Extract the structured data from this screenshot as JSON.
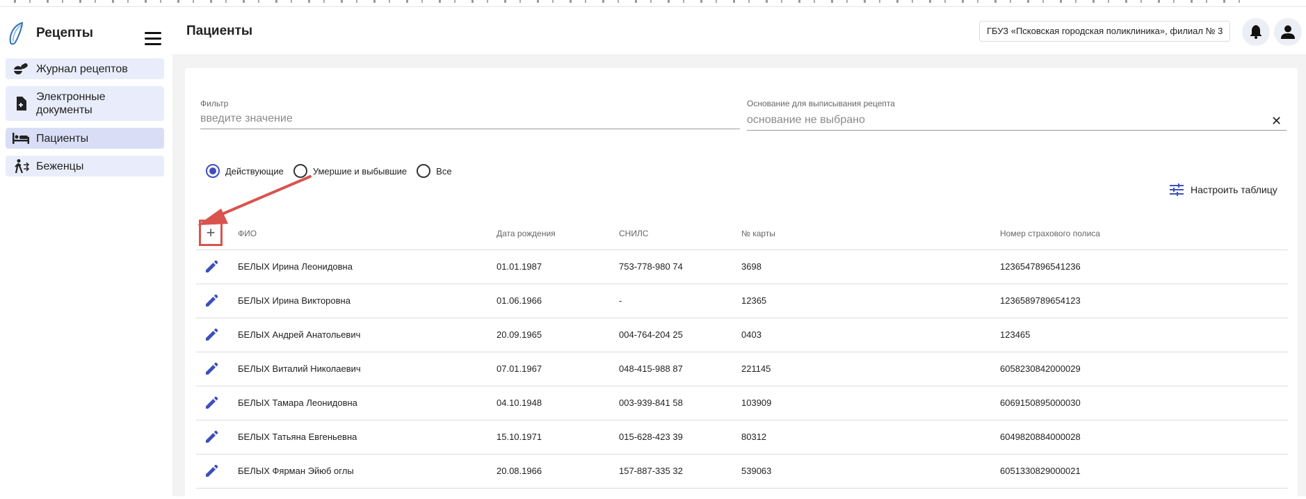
{
  "app": {
    "title": "Рецепты"
  },
  "sidebar": {
    "items": [
      {
        "label": "Журнал рецептов",
        "icon": "pills-icon"
      },
      {
        "label": "Электронные документы",
        "icon": "document-add-icon"
      },
      {
        "label": "Пациенты",
        "icon": "bed-icon",
        "active": true
      },
      {
        "label": "Беженцы",
        "icon": "walking-person-icon"
      }
    ]
  },
  "header": {
    "title": "Пациенты",
    "organization": "ГБУЗ «Псковская городская поликлиника», филиал № 3"
  },
  "filters": {
    "filter_label": "Фильтр",
    "filter_placeholder": "введите значение",
    "basis_label": "Основание для выписывания рецепта",
    "basis_placeholder": "основание не выбрано"
  },
  "status_options": [
    {
      "label": "Действующие",
      "checked": true
    },
    {
      "label": "Умершие и выбывшие",
      "checked": false
    },
    {
      "label": "Все",
      "checked": false
    }
  ],
  "configure_table": {
    "label": "Настроить таблицу"
  },
  "table": {
    "add_symbol": "+",
    "columns": [
      "ФИО",
      "Дата рождения",
      "СНИЛС",
      "№ карты",
      "Номер страхового полиса"
    ],
    "rows": [
      {
        "name": "БЕЛЫХ Ирина Леонидовна",
        "birth": "01.01.1987",
        "snils": "753-778-980 74",
        "card": "3698",
        "policy": "1236547896541236"
      },
      {
        "name": "БЕЛЫХ Ирина Викторовна",
        "birth": "01.06.1966",
        "snils": "-",
        "card": "12365",
        "policy": "1236589789654123"
      },
      {
        "name": "БЕЛЫХ Андрей Анатольевич",
        "birth": "20.09.1965",
        "snils": "004-764-204 25",
        "card": "0403",
        "policy": "123465"
      },
      {
        "name": "БЕЛЫХ Виталий Николаевич",
        "birth": "07.01.1967",
        "snils": "048-415-988 87",
        "card": "221145",
        "policy": "6058230842000029"
      },
      {
        "name": "БЕЛЫХ Тамара Леонидовна",
        "birth": "04.10.1948",
        "snils": "003-939-841 58",
        "card": "103909",
        "policy": "6069150895000030"
      },
      {
        "name": "БЕЛЫХ Татьяна Евгеньевна",
        "birth": "15.10.1971",
        "snils": "015-628-423 39",
        "card": "80312",
        "policy": "6049820884000028"
      },
      {
        "name": "БЕЛЫХ Фярман Эйюб оглы",
        "birth": "20.08.1966",
        "snils": "157-887-335 32",
        "card": "539063",
        "policy": "6051330829000021"
      }
    ]
  },
  "colors": {
    "accent": "#3d4fbb",
    "highlight": "#d9534f",
    "nav_bg": "#e9edfb"
  }
}
